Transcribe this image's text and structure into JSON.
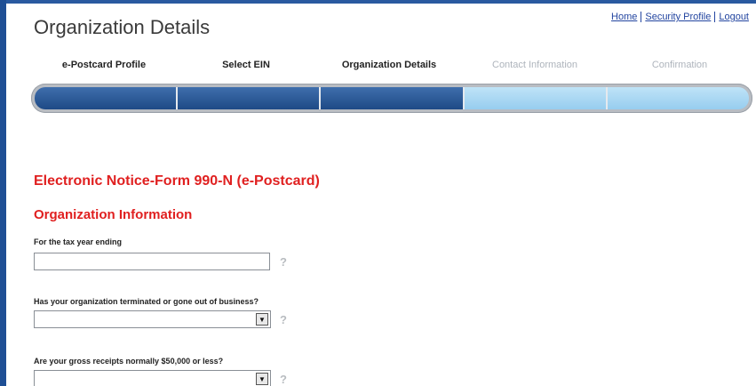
{
  "header": {
    "title": "Organization Details",
    "links": [
      "Home",
      "Security Profile",
      "Logout"
    ]
  },
  "steps": [
    {
      "label": "e-Postcard Profile",
      "active": true
    },
    {
      "label": "Select EIN",
      "active": true
    },
    {
      "label": "Organization Details",
      "active": true
    },
    {
      "label": "Contact Information",
      "active": false
    },
    {
      "label": "Confirmation",
      "active": false
    }
  ],
  "progress": {
    "completed_steps": 3,
    "total_steps": 5
  },
  "main": {
    "form_title": "Electronic Notice-Form 990-N (e-Postcard)",
    "section_title": "Organization Information",
    "questions": [
      {
        "label": "For the tax year ending",
        "type": "text",
        "value": ""
      },
      {
        "label": "Has your organization terminated or gone out of business?",
        "type": "select",
        "value": ""
      },
      {
        "label": "Are your gross receipts normally $50,000 or less?",
        "type": "select",
        "value": ""
      }
    ]
  },
  "colors": {
    "accent": "#e02020",
    "progress_done": "#1e4a86",
    "progress_todo": "#a8d7f2",
    "frame": "#1f4f95"
  },
  "icons": {
    "help": "help-icon",
    "dropdown": "dropdown-arrow-icon"
  }
}
